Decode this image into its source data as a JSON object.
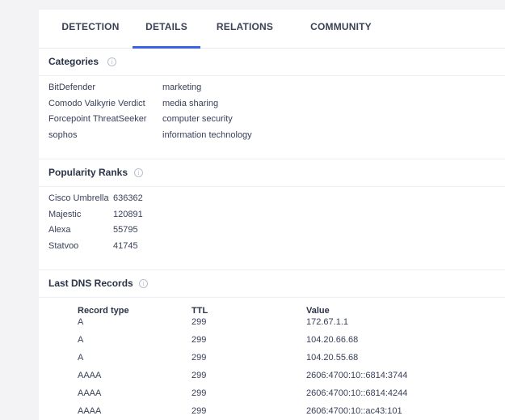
{
  "tabs": [
    "DETECTION",
    "DETAILS",
    "RELATIONS",
    "COMMUNITY"
  ],
  "active_tab": "DETAILS",
  "categories": {
    "title": "Categories",
    "rows": [
      {
        "vendor": "BitDefender",
        "category": "marketing"
      },
      {
        "vendor": "Comodo Valkyrie Verdict",
        "category": "media sharing"
      },
      {
        "vendor": "Forcepoint ThreatSeeker",
        "category": "computer security"
      },
      {
        "vendor": "sophos",
        "category": "information technology"
      }
    ]
  },
  "popularity": {
    "title": "Popularity Ranks",
    "rows": [
      {
        "source": "Cisco Umbrella",
        "rank": "636362"
      },
      {
        "source": "Majestic",
        "rank": "120891"
      },
      {
        "source": "Alexa",
        "rank": "55795"
      },
      {
        "source": "Statvoo",
        "rank": "41745"
      }
    ]
  },
  "dns": {
    "title": "Last DNS Records",
    "headers": {
      "type": "Record type",
      "ttl": "TTL",
      "value": "Value"
    },
    "rows": [
      {
        "type": "A",
        "ttl": "299",
        "value": "172.67.1.1"
      },
      {
        "type": "A",
        "ttl": "299",
        "value": "104.20.66.68"
      },
      {
        "type": "A",
        "ttl": "299",
        "value": "104.20.55.68"
      },
      {
        "type": "AAAA",
        "ttl": "299",
        "value": "2606:4700:10::6814:3744"
      },
      {
        "type": "AAAA",
        "ttl": "299",
        "value": "2606:4700:10::6814:4244"
      },
      {
        "type": "AAAA",
        "ttl": "299",
        "value": "2606:4700:10::ac43:101"
      }
    ]
  },
  "info_icon_glyph": "i",
  "colors": {
    "accent": "#3b61e6",
    "text": "#39415a"
  }
}
